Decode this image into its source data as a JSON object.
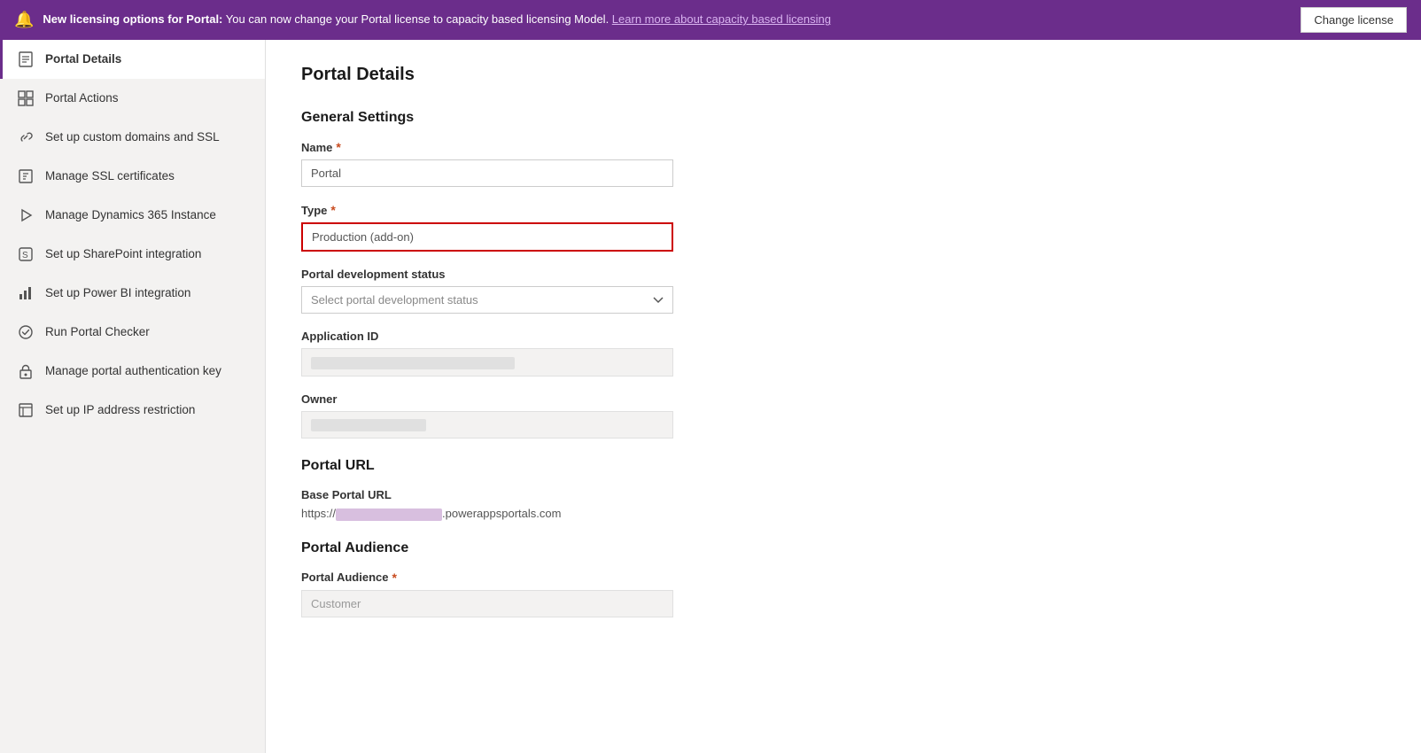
{
  "banner": {
    "icon": "🔔",
    "text_prefix": "New licensing options for Portal:",
    "text_body": " You can now change your Portal license to capacity based licensing Model. ",
    "link_text": "Learn more about capacity based licensing",
    "button_label": "Change license"
  },
  "sidebar": {
    "items": [
      {
        "id": "portal-details",
        "label": "Portal Details",
        "icon": "☰",
        "active": true
      },
      {
        "id": "portal-actions",
        "label": "Portal Actions",
        "icon": "⊞"
      },
      {
        "id": "custom-domains",
        "label": "Set up custom domains and SSL",
        "icon": "🔗"
      },
      {
        "id": "ssl-certs",
        "label": "Manage SSL certificates",
        "icon": "📄"
      },
      {
        "id": "dynamics-365",
        "label": "Manage Dynamics 365 Instance",
        "icon": "▶"
      },
      {
        "id": "sharepoint",
        "label": "Set up SharePoint integration",
        "icon": "S"
      },
      {
        "id": "power-bi",
        "label": "Set up Power BI integration",
        "icon": "📊"
      },
      {
        "id": "portal-checker",
        "label": "Run Portal Checker",
        "icon": "✓"
      },
      {
        "id": "auth-key",
        "label": "Manage portal authentication key",
        "icon": "🔒"
      },
      {
        "id": "ip-restriction",
        "label": "Set up IP address restriction",
        "icon": "📋"
      }
    ]
  },
  "content": {
    "page_title": "Portal Details",
    "general_settings_label": "General Settings",
    "name_label": "Name",
    "name_required": "*",
    "name_placeholder": "Portal",
    "type_label": "Type",
    "type_required": "*",
    "type_value": "Production (add-on)",
    "portal_dev_status_label": "Portal development status",
    "portal_dev_status_placeholder": "Select portal development status",
    "application_id_label": "Application ID",
    "owner_label": "Owner",
    "portal_url_section": "Portal URL",
    "base_portal_url_label": "Base Portal URL",
    "base_portal_url_prefix": "https://",
    "base_portal_url_suffix": ".powerappsportals.com",
    "portal_audience_section": "Portal Audience",
    "portal_audience_label": "Portal Audience",
    "portal_audience_required": "*",
    "portal_audience_value": "Customer"
  }
}
